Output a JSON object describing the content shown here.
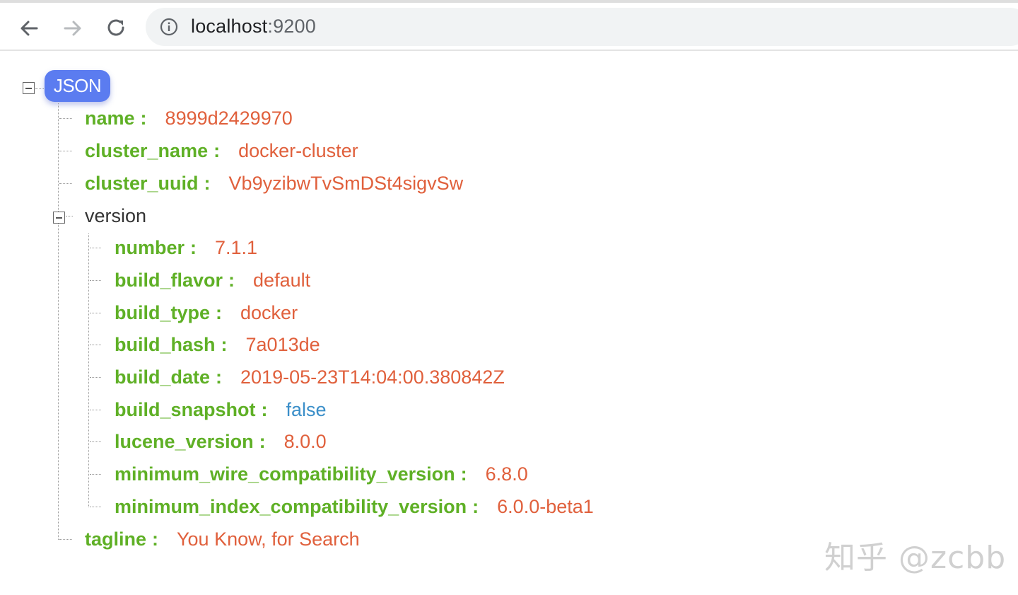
{
  "browser": {
    "url_host": "localhost",
    "url_port": ":9200"
  },
  "viewer": {
    "root_label": "JSON",
    "fields": [
      {
        "key": "name",
        "value": "8999d2429970"
      },
      {
        "key": "cluster_name",
        "value": "docker-cluster"
      },
      {
        "key": "cluster_uuid",
        "value": "Vb9yzibwTvSmDSt4sigvSw"
      }
    ],
    "version": {
      "label": "version",
      "fields": [
        {
          "key": "number",
          "value": "7.1.1"
        },
        {
          "key": "build_flavor",
          "value": "default"
        },
        {
          "key": "build_type",
          "value": "docker"
        },
        {
          "key": "build_hash",
          "value": "7a013de"
        },
        {
          "key": "build_date",
          "value": "2019-05-23T14:04:00.380842Z"
        },
        {
          "key": "build_snapshot",
          "value": "false"
        },
        {
          "key": "lucene_version",
          "value": "8.0.0"
        },
        {
          "key": "minimum_wire_compatibility_version",
          "value": "6.8.0"
        },
        {
          "key": "minimum_index_compatibility_version",
          "value": "6.0.0-beta1"
        }
      ]
    },
    "tagline": {
      "key": "tagline",
      "value": "You Know, for Search"
    },
    "colon": ":"
  },
  "watermark": "知乎 @zcbb",
  "colors": {
    "key": "#5fb026",
    "string_value": "#e0603c",
    "boolean_value": "#3b8fc9",
    "badge": "#5b7cf0"
  }
}
